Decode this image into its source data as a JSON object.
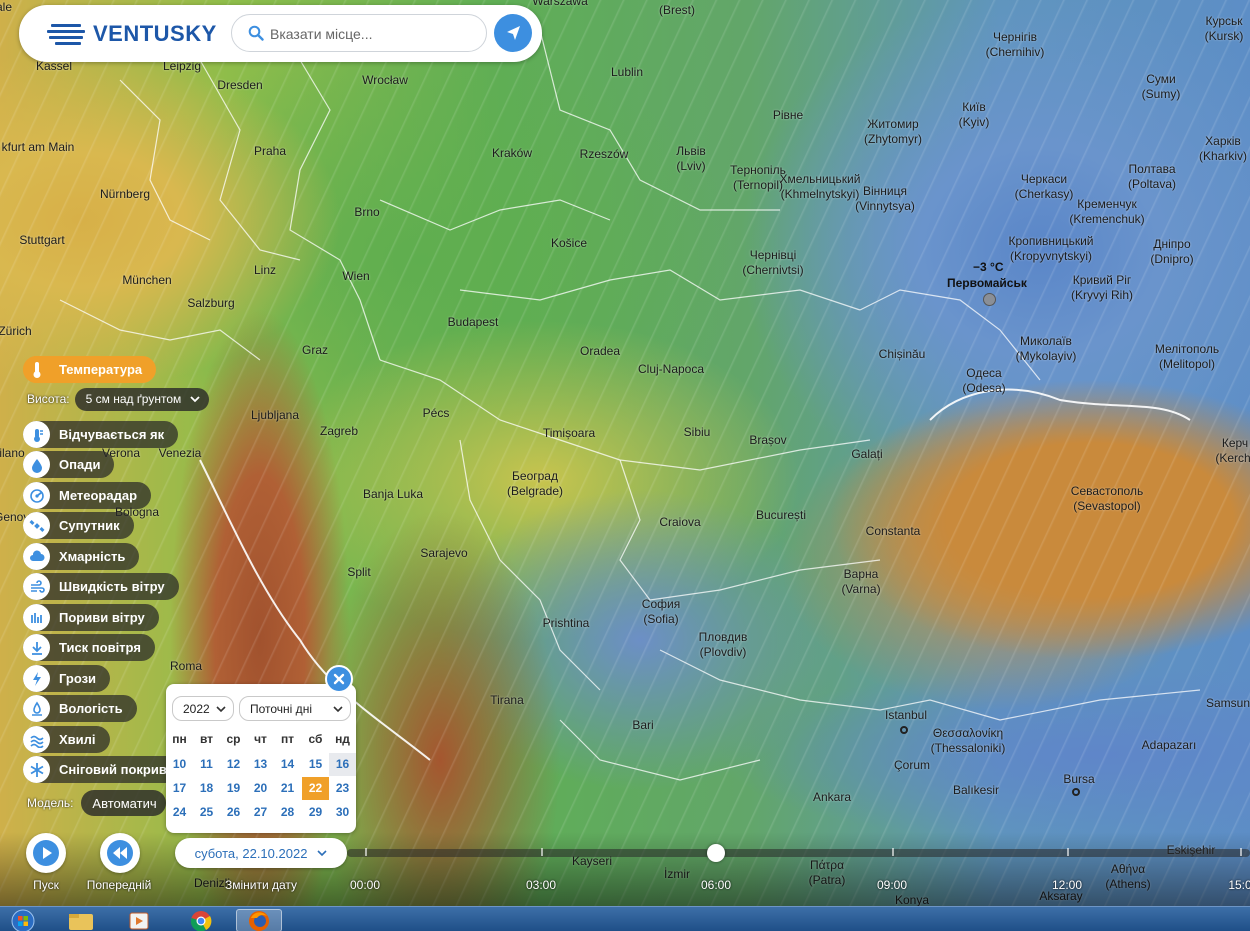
{
  "app": {
    "brand": "VENTUSKY"
  },
  "search": {
    "placeholder": "Вказати місце..."
  },
  "colors": {
    "accent": "#f0a029",
    "brand": "#1d57a8",
    "link_blue": "#2c6fb9",
    "button_blue": "#3d8fe0"
  },
  "map": {
    "cities": [
      {
        "name": "Warszawa",
        "sub": ""
      },
      {
        "name": "(Brest)",
        "sub": ""
      },
      {
        "name": "Чернігів",
        "sub": "(Chernihiv)"
      },
      {
        "name": "Курськ",
        "sub": "(Kursk)"
      },
      {
        "name": "Kassel",
        "sub": ""
      },
      {
        "name": "Leipzig",
        "sub": ""
      },
      {
        "name": "Lublin",
        "sub": ""
      },
      {
        "name": "Wrocław",
        "sub": ""
      },
      {
        "name": "Dresden",
        "sub": ""
      },
      {
        "name": "Суми",
        "sub": "(Sumy)"
      },
      {
        "name": "Рівне",
        "sub": ""
      },
      {
        "name": "Київ",
        "sub": "(Kyiv)"
      },
      {
        "name": "Житомир",
        "sub": "(Zhytomyr)"
      },
      {
        "name": "Харків",
        "sub": "(Kharkiv)"
      },
      {
        "name": "kfurt am Main",
        "sub": ""
      },
      {
        "name": "Praha",
        "sub": ""
      },
      {
        "name": "Kraków",
        "sub": ""
      },
      {
        "name": "Rzeszów",
        "sub": ""
      },
      {
        "name": "Львів",
        "sub": "(Lviv)"
      },
      {
        "name": "Тернопіль",
        "sub": "(Ternopil)"
      },
      {
        "name": "Хмельницький",
        "sub": "(Khmelnytskyi)"
      },
      {
        "name": "Вінниця",
        "sub": "(Vinnytsya)"
      },
      {
        "name": "Черкаси",
        "sub": "(Cherkasy)"
      },
      {
        "name": "Полтава",
        "sub": "(Poltava)"
      },
      {
        "name": "Кременчук",
        "sub": "(Kremenchuk)"
      },
      {
        "name": "Nürnberg",
        "sub": ""
      },
      {
        "name": "Brno",
        "sub": ""
      },
      {
        "name": "Stuttgart",
        "sub": ""
      },
      {
        "name": "Košice",
        "sub": ""
      },
      {
        "name": "Кропивницький",
        "sub": "(Kropyvnytskyi)"
      },
      {
        "name": "Дніпро",
        "sub": "(Dnipro)"
      },
      {
        "name": "Чернівці",
        "sub": "(Chernivtsi)"
      },
      {
        "name": "Linz",
        "sub": ""
      },
      {
        "name": "Wien",
        "sub": ""
      },
      {
        "name": "München",
        "sub": ""
      },
      {
        "name": "Кривий Ріг",
        "sub": "(Kryvyi Rih)"
      },
      {
        "name": "Salzburg",
        "sub": ""
      },
      {
        "name": "Zürich",
        "sub": ""
      },
      {
        "name": "Budapest",
        "sub": ""
      },
      {
        "name": "Миколаїв",
        "sub": "(Mykolayiv)"
      },
      {
        "name": "Мелітополь",
        "sub": "(Melitopol)"
      },
      {
        "name": "Graz",
        "sub": ""
      },
      {
        "name": "Oradea",
        "sub": ""
      },
      {
        "name": "Chișinău",
        "sub": ""
      },
      {
        "name": "Cluj-Napoca",
        "sub": ""
      },
      {
        "name": "Одеса",
        "sub": "(Odesa)"
      },
      {
        "name": "Ljubljana",
        "sub": ""
      },
      {
        "name": "Pécs",
        "sub": ""
      },
      {
        "name": "Zagreb",
        "sub": ""
      },
      {
        "name": "Timișoara",
        "sub": ""
      },
      {
        "name": "Sibiu",
        "sub": ""
      },
      {
        "name": "Brașov",
        "sub": ""
      },
      {
        "name": "Керч",
        "sub": "(Kerch)"
      },
      {
        "name": "Verona",
        "sub": ""
      },
      {
        "name": "Venezia",
        "sub": ""
      },
      {
        "name": "Milano",
        "sub": ""
      },
      {
        "name": "Galați",
        "sub": ""
      },
      {
        "name": "Београд",
        "sub": "(Belgrade)"
      },
      {
        "name": "Banja Luka",
        "sub": ""
      },
      {
        "name": "Севастополь",
        "sub": "(Sevastopol)"
      },
      {
        "name": "Genova",
        "sub": ""
      },
      {
        "name": "Bologna",
        "sub": ""
      },
      {
        "name": "Craiova",
        "sub": ""
      },
      {
        "name": "București",
        "sub": ""
      },
      {
        "name": "Constanta",
        "sub": ""
      },
      {
        "name": "Sarajevo",
        "sub": ""
      },
      {
        "name": "Split",
        "sub": ""
      },
      {
        "name": "Варна",
        "sub": "(Varna)"
      },
      {
        "name": "София",
        "sub": "(Sofia)"
      },
      {
        "name": "Prishtina",
        "sub": ""
      },
      {
        "name": "Пловдив",
        "sub": "(Plovdiv)"
      },
      {
        "name": "Roma",
        "sub": ""
      },
      {
        "name": "Tirana",
        "sub": ""
      },
      {
        "name": "Samsun",
        "sub": ""
      },
      {
        "name": "Istanbul",
        "sub": ""
      },
      {
        "name": "Bari",
        "sub": ""
      },
      {
        "name": "Θεσσαλονίκη",
        "sub": "(Thessaloniki)"
      },
      {
        "name": "Adapazarı",
        "sub": ""
      },
      {
        "name": "Çorum",
        "sub": ""
      },
      {
        "name": "Bursa",
        "sub": ""
      },
      {
        "name": "Ankara",
        "sub": ""
      },
      {
        "name": "Balıkesir",
        "sub": ""
      },
      {
        "name": "Eskişehir",
        "sub": ""
      },
      {
        "name": "Kayseri",
        "sub": ""
      },
      {
        "name": "Πάτρα",
        "sub": "(Patra)"
      },
      {
        "name": "İzmir",
        "sub": ""
      },
      {
        "name": "Αθήνα",
        "sub": "(Athens)"
      },
      {
        "name": "Aksaray",
        "sub": ""
      },
      {
        "name": "Konya",
        "sub": ""
      },
      {
        "name": "Denizli",
        "sub": ""
      },
      {
        "name": "Pale",
        "sub": ""
      }
    ],
    "selected_point": {
      "temperature": "−3 °C",
      "name": "Первомайськ"
    }
  },
  "layers": {
    "active": {
      "label": "Температура",
      "icon": "thermometer-icon"
    },
    "height_label": "Висота:",
    "height_value": "5 см над ґрунтом",
    "items": [
      {
        "label": "Відчувається як",
        "icon": "feels-like-icon"
      },
      {
        "label": "Опади",
        "icon": "raindrop-icon"
      },
      {
        "label": "Метеорадар",
        "icon": "radar-icon"
      },
      {
        "label": "Супутник",
        "icon": "satellite-icon"
      },
      {
        "label": "Хмарність",
        "icon": "cloud-icon"
      },
      {
        "label": "Швидкість вітру",
        "icon": "wind-icon"
      },
      {
        "label": "Пориви вітру",
        "icon": "wind-gust-icon"
      },
      {
        "label": "Тиск повітря",
        "icon": "pressure-icon"
      },
      {
        "label": "Грози",
        "icon": "lightning-icon"
      },
      {
        "label": "Вологість",
        "icon": "humidity-icon"
      },
      {
        "label": "Хвилі",
        "icon": "waves-icon"
      },
      {
        "label": "Сніговий покрив",
        "icon": "snowflake-icon"
      }
    ],
    "model_label": "Модель:",
    "model_value": "Автоматич"
  },
  "calendar": {
    "year": "2022",
    "range": "Поточні дні",
    "weekdays": [
      "пн",
      "вт",
      "ср",
      "чт",
      "пт",
      "сб",
      "нд"
    ],
    "weeks": [
      [
        "10",
        "11",
        "12",
        "13",
        "14",
        "15",
        "16"
      ],
      [
        "17",
        "18",
        "19",
        "20",
        "21",
        "22",
        "23"
      ],
      [
        "24",
        "25",
        "26",
        "27",
        "28",
        "29",
        "30"
      ]
    ],
    "selected_day": "22"
  },
  "timeline": {
    "play_label": "Пуск",
    "prev_label": "Попередній",
    "change_date_label": "Змінити дату",
    "date": "субота, 22.10.2022",
    "hours": [
      "00:00",
      "03:00",
      "06:00",
      "09:00",
      "12:00",
      "15:0"
    ],
    "current_hour": "06:00"
  },
  "taskbar": {
    "items": [
      "start-orb-icon",
      "file-explorer-icon",
      "media-player-icon",
      "chrome-icon",
      "firefox-icon"
    ],
    "active_item": "firefox-icon"
  }
}
